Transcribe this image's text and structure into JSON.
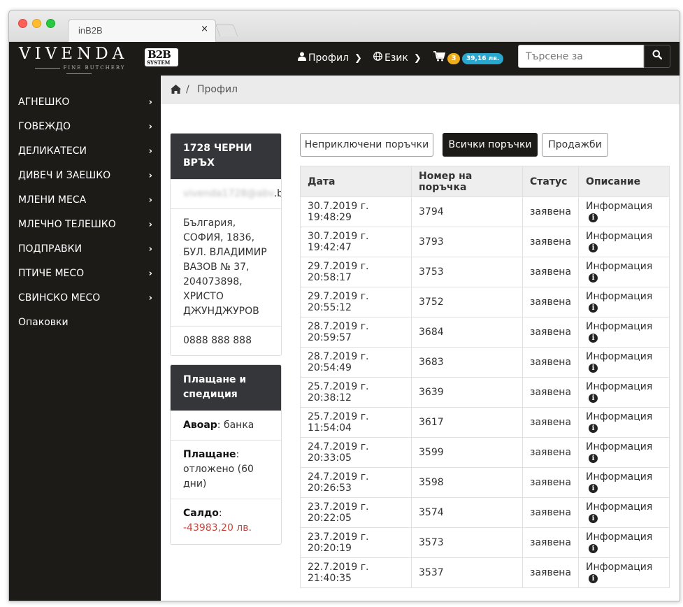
{
  "browser": {
    "tab_title": "inB2B",
    "tab_close": "×"
  },
  "navbar": {
    "logo_text": "VIVENDA",
    "logo_subtitle": "FINE BUTCHERY",
    "b2b_main": "B2B",
    "b2b_sub": "SYSTEM",
    "profile_label": "Профил",
    "language_label": "Език",
    "cart_count": "3",
    "cart_total": "39,16 лв.",
    "search_placeholder": "Търсене за"
  },
  "sidebar": {
    "items": [
      {
        "label": "АГНЕШКО",
        "has_children": true
      },
      {
        "label": "ГОВЕЖДО",
        "has_children": true
      },
      {
        "label": "ДЕЛИКАТЕСИ",
        "has_children": true
      },
      {
        "label": "ДИВЕЧ И ЗАЕШКО",
        "has_children": true
      },
      {
        "label": "МЛЕНИ МЕСА",
        "has_children": true
      },
      {
        "label": "МЛЕЧНО ТЕЛЕШКО",
        "has_children": true
      },
      {
        "label": "ПОДПРАВКИ",
        "has_children": true
      },
      {
        "label": "ПТИЧЕ МЕСО",
        "has_children": true
      },
      {
        "label": "СВИНСКО МЕСО",
        "has_children": true
      },
      {
        "label": "Опаковки",
        "has_children": false
      }
    ]
  },
  "breadcrumb": {
    "separator": "/",
    "current": "Профил"
  },
  "customer_panel": {
    "title": "1728 ЧЕРНИ ВРЪХ",
    "email_masked": "vivenda1728@abv",
    "email_suffix": ".bg",
    "address": "България, СОФИЯ, 1836, БУЛ. ВЛАДИМИР ВАЗОВ № 37, 204073898, ХРИСТО ДЖУНДЖУРОВ",
    "phone": "0888 888 888"
  },
  "payment_panel": {
    "title": "Плащане и спедиция",
    "courier_label": "Авоар",
    "courier_value": ": банка",
    "payment_label": "Плащане",
    "payment_value": ": отложено (60 дни)",
    "balance_label": "Салдо",
    "balance_sep": ": ",
    "balance_value": "-43983,20 лв."
  },
  "order_tabs": {
    "pending": "Неприключени поръчки",
    "all": "Всички поръчки",
    "sales": "Продажби",
    "active": "all"
  },
  "orders_table": {
    "columns": [
      "Дата",
      "Номер на поръчка",
      "Статус",
      "Описание"
    ],
    "rows": [
      {
        "date": "30.7.2019 г. 19:48:29",
        "number": "3794",
        "status": "заявена",
        "desc": "Информация"
      },
      {
        "date": "30.7.2019 г. 19:42:47",
        "number": "3793",
        "status": "заявена",
        "desc": "Информация"
      },
      {
        "date": "29.7.2019 г. 20:58:17",
        "number": "3753",
        "status": "заявена",
        "desc": "Информация"
      },
      {
        "date": "29.7.2019 г. 20:55:12",
        "number": "3752",
        "status": "заявена",
        "desc": "Информация"
      },
      {
        "date": "28.7.2019 г. 20:59:57",
        "number": "3684",
        "status": "заявена",
        "desc": "Информация"
      },
      {
        "date": "28.7.2019 г. 20:54:49",
        "number": "3683",
        "status": "заявена",
        "desc": "Информация"
      },
      {
        "date": "25.7.2019 г. 20:38:12",
        "number": "3639",
        "status": "заявена",
        "desc": "Информация"
      },
      {
        "date": "25.7.2019 г. 11:54:04",
        "number": "3617",
        "status": "заявена",
        "desc": "Информация"
      },
      {
        "date": "24.7.2019 г. 20:33:05",
        "number": "3599",
        "status": "заявена",
        "desc": "Информация"
      },
      {
        "date": "24.7.2019 г. 20:26:53",
        "number": "3598",
        "status": "заявена",
        "desc": "Информация"
      },
      {
        "date": "23.7.2019 г. 20:22:05",
        "number": "3574",
        "status": "заявена",
        "desc": "Информация"
      },
      {
        "date": "23.7.2019 г. 20:20:19",
        "number": "3573",
        "status": "заявена",
        "desc": "Информация"
      },
      {
        "date": "22.7.2019 г. 21:40:35",
        "number": "3537",
        "status": "заявена",
        "desc": "Информация"
      }
    ]
  },
  "colors": {
    "dark": "#1d1b18",
    "panel_head": "#35363a",
    "badge_count": "#f0ad1b",
    "badge_money": "#2aa7cf",
    "negative": "#c9473c"
  },
  "icons": {
    "user": "user-icon",
    "globe": "globe-icon",
    "cart": "cart-icon",
    "search": "search-icon",
    "home": "home-icon",
    "info": "info-icon",
    "chevron": "chevron-right-icon"
  }
}
